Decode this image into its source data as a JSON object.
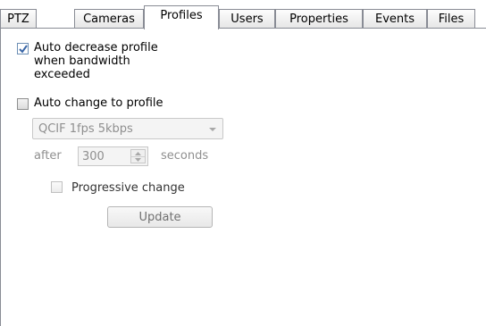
{
  "tabs": [
    {
      "label": "PTZ"
    },
    {
      "label": "Cameras"
    },
    {
      "label": "Profiles"
    },
    {
      "label": "Users"
    },
    {
      "label": "Properties"
    },
    {
      "label": "Events"
    },
    {
      "label": "Files"
    }
  ],
  "active_tab": "Profiles",
  "profiles": {
    "auto_decrease": {
      "checked": true,
      "label_lines": [
        "Auto decrease profile",
        "when bandwidth",
        "exceeded"
      ]
    },
    "auto_change": {
      "checked": false,
      "label": "Auto change to profile"
    },
    "profile_select": {
      "value": "QCIF 1fps 5kbps",
      "enabled": false
    },
    "after_label": "after",
    "seconds_value": "300",
    "seconds_label": "seconds",
    "progressive_change": {
      "checked": false,
      "enabled": false,
      "label": "Progressive change"
    },
    "update_button": "Update"
  },
  "colors": {
    "border": "#898c95",
    "disabled_text": "#8f8f8f",
    "check_mark": "#3a66a7"
  }
}
